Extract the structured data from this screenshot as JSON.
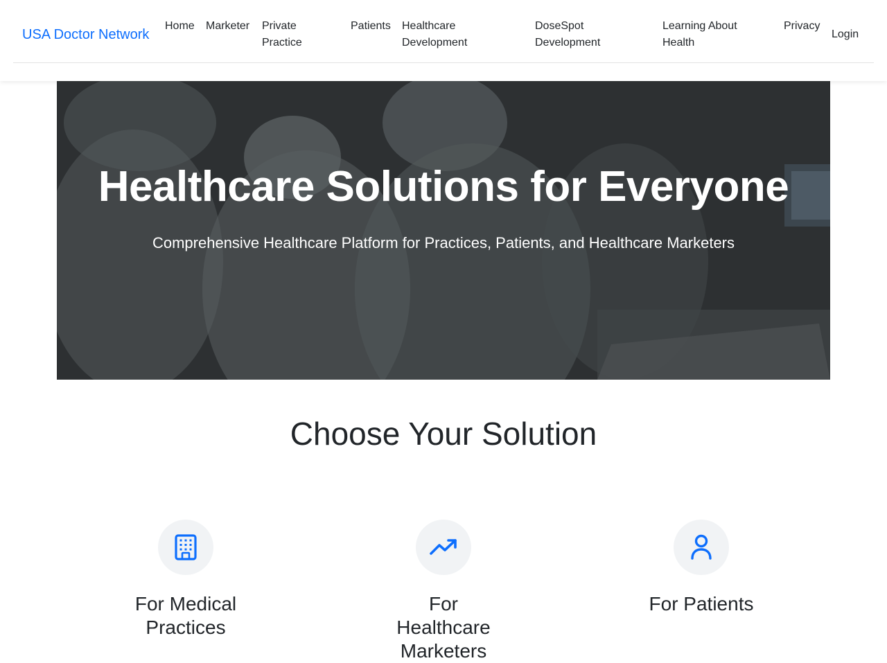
{
  "brand": {
    "name": "USA Doctor Network",
    "color": "#0d6efd"
  },
  "nav": {
    "items": [
      {
        "label": "Home"
      },
      {
        "label": "Marketer"
      },
      {
        "label": "Private Practice"
      },
      {
        "label": "Patients"
      },
      {
        "label": "Healthcare Development"
      },
      {
        "label": "DoseSpot Development"
      },
      {
        "label": "Learning About Health"
      },
      {
        "label": "Privacy"
      }
    ],
    "login_label": "Login"
  },
  "hero": {
    "title": "Healthcare Solutions for Everyone",
    "subtitle": "Comprehensive Healthcare Platform for Practices, Patients, and Healthcare Marketers"
  },
  "solutions": {
    "heading": "Choose Your Solution",
    "cards": [
      {
        "icon": "building-icon",
        "title": "For Medical Practices"
      },
      {
        "icon": "trending-up-icon",
        "title": "For Healthcare Marketers"
      },
      {
        "icon": "user-icon",
        "title": "For Patients"
      }
    ],
    "icon_color": "#0d6efd"
  }
}
